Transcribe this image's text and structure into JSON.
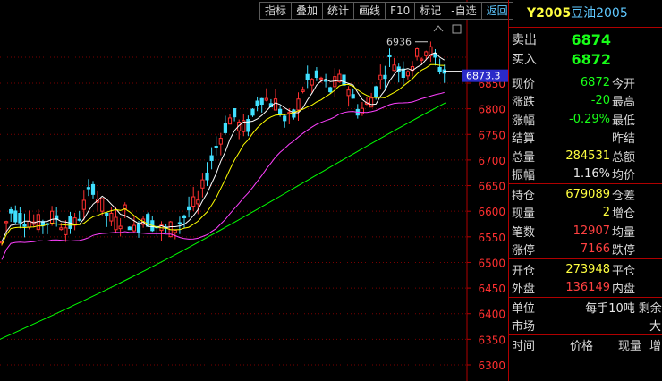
{
  "toolbar": {
    "buttons": [
      "指标",
      "叠加",
      "统计",
      "画线",
      "F10",
      "标记",
      "-自选",
      "返回"
    ]
  },
  "instrument": {
    "code": "Y2005",
    "name": "豆油2005"
  },
  "chart": {
    "high_label": "6936",
    "last_price_tag": "6873.3",
    "y_axis_ticks": [
      "6850",
      "6800",
      "6750",
      "6700",
      "6650",
      "6600",
      "6550",
      "6500",
      "6450",
      "6400",
      "6350",
      "6300"
    ],
    "colors": {
      "up": "#ff3030",
      "down": "#40e0ff",
      "ma5": "#ffffff",
      "ma10": "#ffff00",
      "ma20": "#ff40ff",
      "ma60": "#00ff00",
      "axis": "#b00000"
    }
  },
  "quote": {
    "sell_label": "卖出",
    "sell_price": "6874",
    "buy_label": "买入",
    "buy_price": "6872",
    "rows": [
      {
        "l1": "现价",
        "v1": "6872",
        "c1": "green",
        "l2": "今开"
      },
      {
        "l1": "涨跌",
        "v1": "-20",
        "c1": "green",
        "l2": "最高"
      },
      {
        "l1": "涨幅",
        "v1": "-0.29%",
        "c1": "green",
        "l2": "最低"
      },
      {
        "l1": "结算",
        "v1": "",
        "c1": "green",
        "l2": "昨结"
      },
      {
        "l1": "总量",
        "v1": "284531",
        "c1": "yellow",
        "l2": "总额"
      },
      {
        "l1": "振幅",
        "v1": "1.16%",
        "c1": "white",
        "l2": "均价"
      }
    ],
    "rows2": [
      {
        "l1": "持仓",
        "v1": "679089",
        "c1": "yellow",
        "l2": "仓差"
      },
      {
        "l1": "现量",
        "v1": "2",
        "c1": "yellow",
        "l2": "增仓"
      },
      {
        "l1": "笔数",
        "v1": "12907",
        "c1": "red",
        "l2": "均量"
      },
      {
        "l1": "涨停",
        "v1": "7166",
        "c1": "red",
        "l2": "跌停"
      }
    ],
    "rows3": [
      {
        "l1": "开仓",
        "v1": "273948",
        "c1": "yellow",
        "l2": "平仓"
      },
      {
        "l1": "外盘",
        "v1": "136149",
        "c1": "red",
        "l2": "内盘"
      }
    ],
    "unit": {
      "label": "单位",
      "value": "每手10吨",
      "extra": "剩余"
    },
    "market": {
      "label": "市场",
      "value": "大"
    },
    "trades_header": {
      "time": "时间",
      "price": "价格",
      "qty": "现量",
      "pos": "增"
    }
  }
}
